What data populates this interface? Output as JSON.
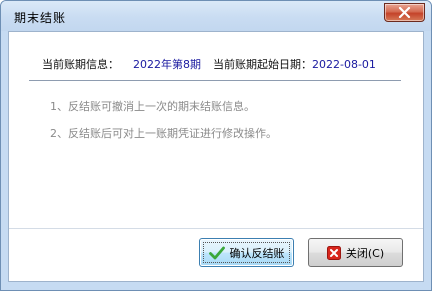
{
  "window": {
    "title": "期末结账"
  },
  "info": {
    "period_label": "当前账期信息：",
    "period_value": "2022年第8期",
    "start_label": "当前账期起始日期：",
    "start_value": "2022-08-01"
  },
  "notes": [
    "1、反结账可撤消上一次的期末结账信息。",
    "2、反结账后可对上一账期凭证进行修改操作。"
  ],
  "buttons": {
    "confirm_label": "确认反结账",
    "close_label": "关闭(C)"
  },
  "colors": {
    "value_text": "#1a1aa0",
    "note_text": "#8a8a8a",
    "confirm_icon": "#3aa83a",
    "close_icon": "#d8261c"
  },
  "icons": {
    "title_close": "close-icon",
    "confirm": "checkmark-icon",
    "close": "cancel-icon"
  }
}
